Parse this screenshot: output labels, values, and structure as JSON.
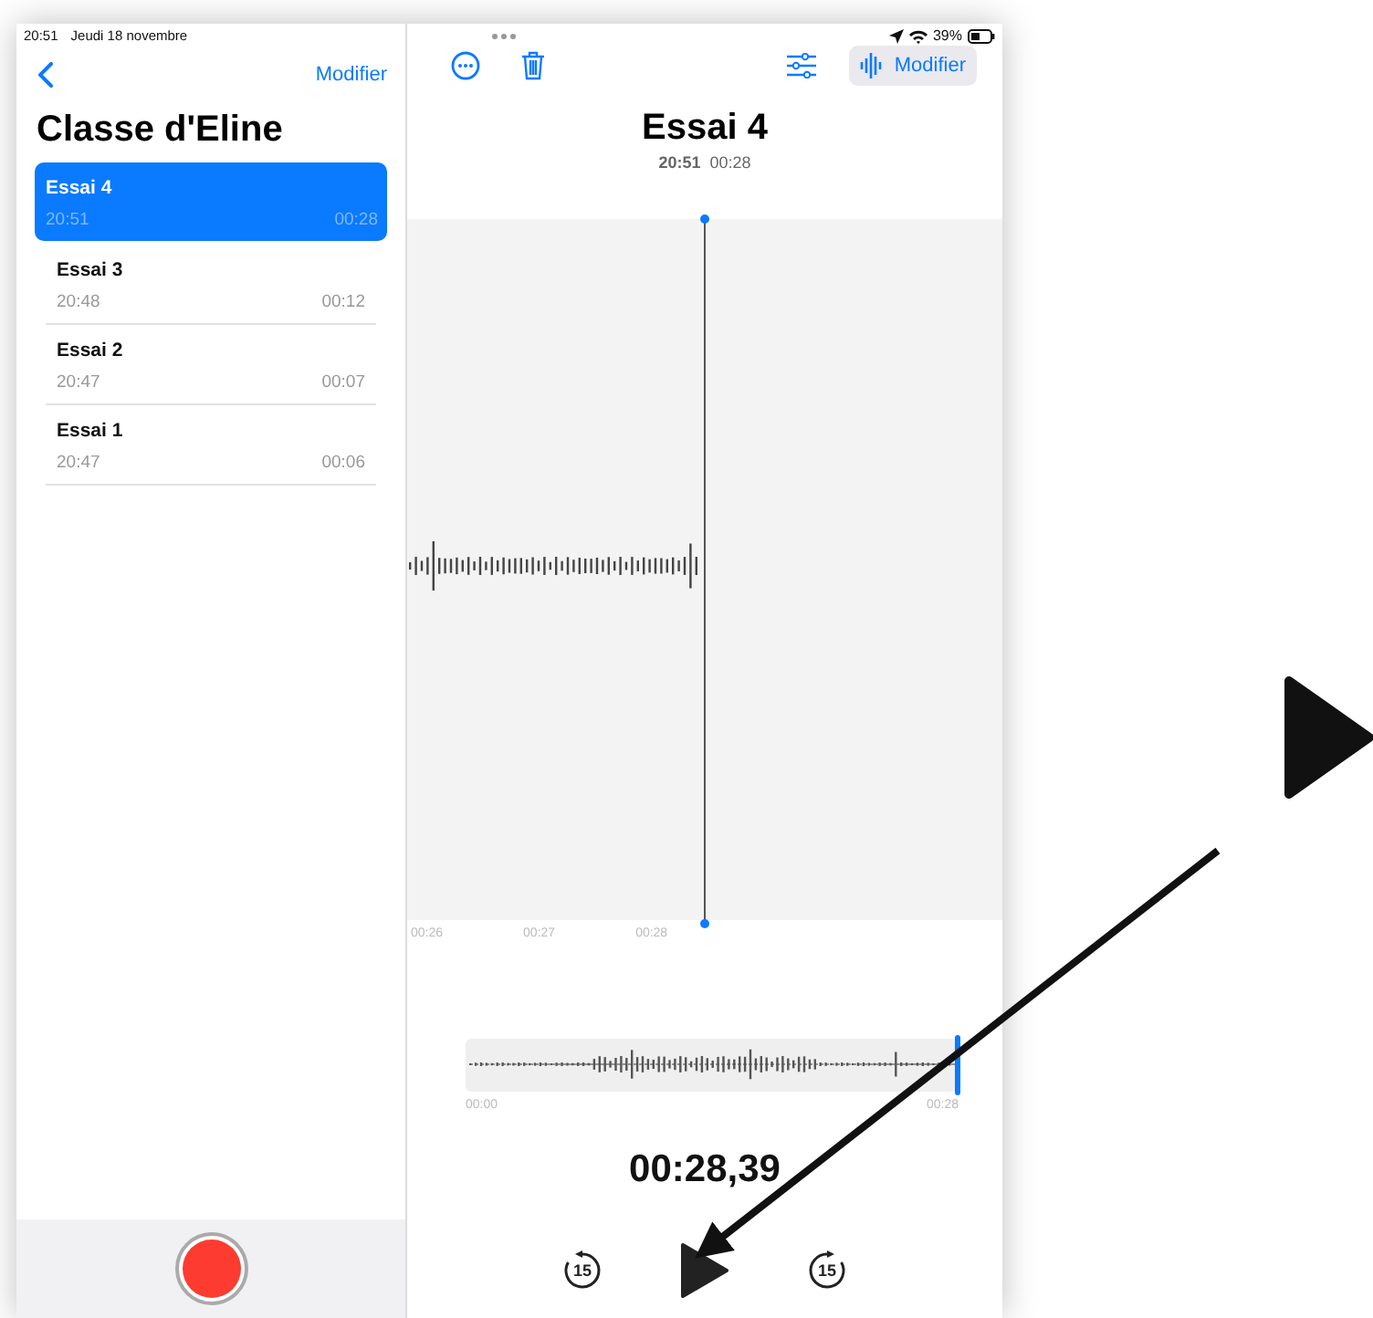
{
  "status_bar": {
    "time": "20:51",
    "date": "Jeudi 18 novembre",
    "battery": "39%"
  },
  "sidebar": {
    "edit_label": "Modifier",
    "title": "Classe d'Eline",
    "recordings": [
      {
        "name": "Essai 4",
        "time": "20:51",
        "duration": "00:28",
        "selected": true
      },
      {
        "name": "Essai 3",
        "time": "20:48",
        "duration": "00:12",
        "selected": false
      },
      {
        "name": "Essai 2",
        "time": "20:47",
        "duration": "00:07",
        "selected": false
      },
      {
        "name": "Essai 1",
        "time": "20:47",
        "duration": "00:06",
        "selected": false
      }
    ]
  },
  "detail": {
    "edit_label": "Modifier",
    "title": "Essai 4",
    "time": "20:51",
    "duration": "00:28",
    "ticks": [
      "00:26",
      "00:27",
      "00:28"
    ],
    "overview": {
      "start": "00:00",
      "end": "00:28",
      "level": 1
    },
    "elapsed": "00:28,39",
    "skip_back": "15",
    "skip_forward": "15"
  }
}
